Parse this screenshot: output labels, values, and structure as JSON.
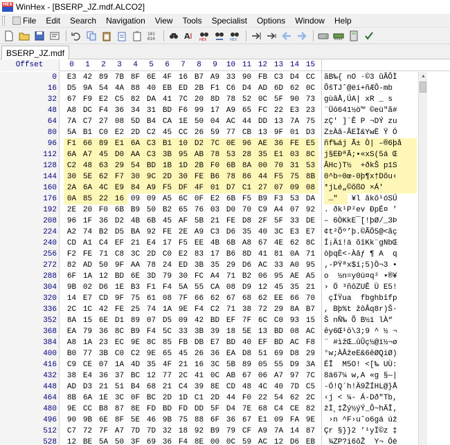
{
  "window": {
    "title": "WinHex - [BSERP_JZ.mdf.ALCO2]",
    "logo_text": "HEX"
  },
  "menu": [
    "File",
    "Edit",
    "Search",
    "Navigation",
    "View",
    "Tools",
    "Specialist",
    "Options",
    "Window",
    "Help"
  ],
  "toolbar": {
    "icons": [
      "new-file-icon",
      "open-file-icon",
      "save-icon",
      "properties-icon",
      "print-icon",
      "undo-icon",
      "copy-icon",
      "paste-icon",
      "paste-special-icon",
      "clipboard-icon",
      "binary-icon",
      "find-icon",
      "find-text-icon",
      "find-hex-icon",
      "replace-icon",
      "replace-hex-icon",
      "goto-offset-icon",
      "goto-jump-icon",
      "back-arrow-icon",
      "forward-arrow-icon",
      "disk-icon",
      "ram-icon",
      "calculator-icon",
      "checksum-icon"
    ]
  },
  "tab": {
    "label": "BSERP_JZ.mdf"
  },
  "hex": {
    "offset_label": "Offset",
    "columns": [
      "0",
      "1",
      "2",
      "3",
      "4",
      "5",
      "6",
      "7",
      "8",
      "9",
      "10",
      "11",
      "12",
      "13",
      "14",
      "15"
    ],
    "rows": [
      {
        "offset": "0",
        "bytes": [
          "E3",
          "42",
          "89",
          "7B",
          "8F",
          "6E",
          "4F",
          "16",
          "B7",
          "A9",
          "33",
          "90",
          "FB",
          "C3",
          "D4",
          "CC"
        ],
        "ascii": "ãB‰{ nO ·©3 ûÃÔÌ"
      },
      {
        "offset": "16",
        "bytes": [
          "D5",
          "9A",
          "54",
          "4A",
          "88",
          "40",
          "EB",
          "ED",
          "2B",
          "F1",
          "C6",
          "D4",
          "AD",
          "6D",
          "62",
          "0C"
        ],
        "ascii": "ÕšTJˆ@ëí+ñÆÔ-mb"
      },
      {
        "offset": "32",
        "bytes": [
          "67",
          "F9",
          "E2",
          "C5",
          "82",
          "DA",
          "41",
          "7C",
          "20",
          "8D",
          "78",
          "52",
          "0C",
          "5F",
          "90",
          "73"
        ],
        "ascii": "gùâÅ‚ÚA| xR _ s"
      },
      {
        "offset": "48",
        "bytes": [
          "A8",
          "DC",
          "F4",
          "36",
          "34",
          "31",
          "BD",
          "F6",
          "99",
          "17",
          "A9",
          "65",
          "FC",
          "22",
          "E3",
          "23"
        ],
        "ascii": "¨Üô641½ö™ ©eü\"ã#"
      },
      {
        "offset": "64",
        "bytes": [
          "7A",
          "C7",
          "27",
          "08",
          "5D",
          "B4",
          "CA",
          "1E",
          "50",
          "04",
          "AC",
          "44",
          "DD",
          "13",
          "7A",
          "75"
        ],
        "ascii": "zÇ' ]´Ê P ¬DÝ zu"
      },
      {
        "offset": "80",
        "bytes": [
          "5A",
          "B1",
          "C0",
          "E2",
          "2D",
          "C2",
          "45",
          "CC",
          "26",
          "59",
          "77",
          "CB",
          "13",
          "9F",
          "01",
          "D3"
        ],
        "ascii": "Z±Àâ-ÂEÌ&YwË Ÿ Ó"
      },
      {
        "offset": "96",
        "bytes": [
          "F1",
          "66",
          "89",
          "E1",
          "6A",
          "C3",
          "B1",
          "10",
          "D2",
          "7C",
          "0E",
          "96",
          "AE",
          "36",
          "FE",
          "E5"
        ],
        "ascii": "ñf‰áj Ã± Ò| –®6þå"
      },
      {
        "offset": "112",
        "bytes": [
          "6A",
          "A7",
          "45",
          "D0",
          "AA",
          "C3",
          "3B",
          "95",
          "AB",
          "78",
          "53",
          "28",
          "35",
          "E1",
          "03",
          "8C"
        ],
        "ascii": "j§EÐªÃ;•«xS(5á Œ"
      },
      {
        "offset": "128",
        "bytes": [
          "C2",
          "48",
          "63",
          "29",
          "54",
          "BD",
          "1B",
          "1D",
          "2B",
          "F0",
          "6B",
          "8A",
          "00",
          "70",
          "31",
          "53"
        ],
        "ascii": "ÂHc)T½  +ðkŠ p1S"
      },
      {
        "offset": "144",
        "bytes": [
          "30",
          "5E",
          "62",
          "F7",
          "30",
          "9C",
          "2D",
          "30",
          "FE",
          "B6",
          "78",
          "86",
          "44",
          "F5",
          "75",
          "8B"
        ],
        "ascii": "0^b÷0œ-0þ¶x†Dõu‹"
      },
      {
        "offset": "160",
        "bytes": [
          "2A",
          "6A",
          "4C",
          "E9",
          "84",
          "A9",
          "F5",
          "DF",
          "4F",
          "01",
          "D7",
          "C1",
          "27",
          "07",
          "09",
          "08"
        ],
        "ascii": "*jLé„©õßO ×Á'   "
      },
      {
        "offset": "176",
        "bytes": [
          "0A",
          "85",
          "22",
          "16",
          "09",
          "09",
          "A5",
          "6C",
          "0F",
          "E2",
          "6B",
          "F5",
          "B9",
          "F3",
          "53",
          "DA"
        ],
        "ascii": " …\"   ¥l âkõ¹óSÚ"
      },
      {
        "offset": "192",
        "bytes": [
          "2E",
          "20",
          "F0",
          "6B",
          "B9",
          "50",
          "B2",
          "65",
          "76",
          "03",
          "D0",
          "70",
          "C9",
          "A4",
          "07",
          "92"
        ],
        "ascii": ". ðk¹P²ev ÐpÉ¤ ’"
      },
      {
        "offset": "208",
        "bytes": [
          "96",
          "1F",
          "36",
          "D2",
          "4B",
          "6B",
          "45",
          "AF",
          "5B",
          "21",
          "FE",
          "D8",
          "2F",
          "5F",
          "33",
          "DE"
        ],
        "ascii": "– 6ÒKkE¯[!þØ/_3Þ"
      },
      {
        "offset": "224",
        "bytes": [
          "A2",
          "74",
          "B2",
          "D5",
          "BA",
          "92",
          "FE",
          "2E",
          "A9",
          "C3",
          "D6",
          "35",
          "40",
          "3C",
          "E3",
          "E7"
        ],
        "ascii": "¢t²Õº’þ.©ÃÖ5@<ãç"
      },
      {
        "offset": "240",
        "bytes": [
          "CD",
          "A1",
          "C4",
          "EF",
          "21",
          "E4",
          "17",
          "F5",
          "EE",
          "4B",
          "6B",
          "A8",
          "67",
          "4E",
          "62",
          "8C"
        ],
        "ascii": "Í¡Äï!ä õîKk¨gNbŒ"
      },
      {
        "offset": "256",
        "bytes": [
          "F2",
          "FE",
          "71",
          "C8",
          "3C",
          "2D",
          "C0",
          "E2",
          "83",
          "17",
          "B6",
          "8D",
          "41",
          "81",
          "0A",
          "71"
        ],
        "ascii": "òþqÈ<-Àâƒ ¶ A  q"
      },
      {
        "offset": "272",
        "bytes": [
          "82",
          "AD",
          "50",
          "9F",
          "AA",
          "78",
          "24",
          "ED",
          "3B",
          "35",
          "29",
          "D6",
          "AC",
          "33",
          "A0",
          "95"
        ],
        "ascii": "‚-PŸªx$í;5)Ö¬3 •"
      },
      {
        "offset": "288",
        "bytes": [
          "6F",
          "1A",
          "12",
          "BD",
          "6E",
          "3D",
          "79",
          "30",
          "FC",
          "A4",
          "71",
          "B2",
          "06",
          "95",
          "AE",
          "A5"
        ],
        "ascii": "o  ½n=y0ü¤q² •®¥"
      },
      {
        "offset": "304",
        "bytes": [
          "9B",
          "02",
          "D6",
          "1E",
          "B3",
          "F1",
          "F4",
          "5A",
          "55",
          "CA",
          "08",
          "D9",
          "12",
          "45",
          "35",
          "21"
        ],
        "ascii": "› Ö ³ñôZUÊ Ù E5!"
      },
      {
        "offset": "320",
        "bytes": [
          "14",
          "E7",
          "CD",
          "9F",
          "75",
          "61",
          "08",
          "7F",
          "66",
          "62",
          "67",
          "68",
          "62",
          "EE",
          "66",
          "70"
        ],
        "ascii": " çÍŸua  fbghbîfp"
      },
      {
        "offset": "336",
        "bytes": [
          "2C",
          "1C",
          "42",
          "FE",
          "25",
          "74",
          "1A",
          "9E",
          "F4",
          "C2",
          "71",
          "38",
          "72",
          "29",
          "8A",
          "B7"
        ],
        "ascii": ", Bþ%t žôÂq8r)Š·"
      },
      {
        "offset": "352",
        "bytes": [
          "8A",
          "15",
          "6E",
          "D1",
          "89",
          "07",
          "D5",
          "09",
          "42",
          "BD",
          "EF",
          "7F",
          "6C",
          "C0",
          "93",
          "15"
        ],
        "ascii": "Š nÑ‰ Õ B½ï lÀ“ "
      },
      {
        "offset": "368",
        "bytes": [
          "EA",
          "79",
          "36",
          "8C",
          "B9",
          "F4",
          "5C",
          "33",
          "3B",
          "39",
          "18",
          "5E",
          "13",
          "BD",
          "08",
          "AC"
        ],
        "ascii": "êy6Œ¹ô\\3;9 ^ ½ ¬"
      },
      {
        "offset": "384",
        "bytes": [
          "A8",
          "1A",
          "23",
          "EC",
          "9E",
          "8C",
          "85",
          "FB",
          "DB",
          "E7",
          "BD",
          "40",
          "EF",
          "BD",
          "AC",
          "F8"
        ],
        "ascii": "¨ #ìžŒ…ûÛç½@ï½¬ø"
      },
      {
        "offset": "400",
        "bytes": [
          "B0",
          "77",
          "3B",
          "C0",
          "C2",
          "9E",
          "65",
          "45",
          "26",
          "36",
          "EA",
          "D8",
          "51",
          "69",
          "D8",
          "29"
        ],
        "ascii": "°w;ÀÂžeE&6êØQiØ)"
      },
      {
        "offset": "416",
        "bytes": [
          "C9",
          "CE",
          "07",
          "1A",
          "4D",
          "35",
          "4F",
          "21",
          "16",
          "3C",
          "5B",
          "89",
          "05",
          "55",
          "D9",
          "3A"
        ],
        "ascii": "ÉÎ  M5O! <[‰ UÙ:"
      },
      {
        "offset": "432",
        "bytes": [
          "38",
          "E4",
          "36",
          "37",
          "BC",
          "12",
          "77",
          "2C",
          "41",
          "0C",
          "AB",
          "67",
          "06",
          "A7",
          "97",
          "7C"
        ],
        "ascii": "8ä67¼ w,A «g §—|"
      },
      {
        "offset": "448",
        "bytes": [
          "AD",
          "D3",
          "21",
          "51",
          "B4",
          "68",
          "21",
          "C4",
          "39",
          "8E",
          "CD",
          "48",
          "4C",
          "40",
          "7D",
          "C5"
        ],
        "ascii": "-Ó!Q´h!Ä9ŽÍHL@}Å"
      },
      {
        "offset": "464",
        "bytes": [
          "8B",
          "6A",
          "1E",
          "3C",
          "0F",
          "BC",
          "2D",
          "1D",
          "C1",
          "2D",
          "44",
          "F0",
          "22",
          "54",
          "62",
          "2C"
        ],
        "ascii": "‹j < ¼- Á-Dð\"Tb,"
      },
      {
        "offset": "480",
        "bytes": [
          "9E",
          "CC",
          "B8",
          "87",
          "8E",
          "FD",
          "BD",
          "FD",
          "DD",
          "5F",
          "D4",
          "7E",
          "68",
          "C4",
          "CE",
          "82"
        ],
        "ascii": "žÌ¸‡Žý½ýÝ_Ô~hÄÎ‚"
      },
      {
        "offset": "496",
        "bytes": [
          "90",
          "9B",
          "6E",
          "8F",
          "5E",
          "46",
          "9B",
          "75",
          "88",
          "6F",
          "36",
          "67",
          "E1",
          "09",
          "FA",
          "9E"
        ],
        "ascii": " ›n ^F›uˆo6gá úž"
      },
      {
        "offset": "512",
        "bytes": [
          "C7",
          "72",
          "7F",
          "A7",
          "7D",
          "7D",
          "32",
          "18",
          "92",
          "B9",
          "79",
          "CF",
          "A9",
          "7A",
          "14",
          "87"
        ],
        "ascii": "Çr §}}2 ’¹yÏ©z ‡"
      },
      {
        "offset": "528",
        "bytes": [
          "12",
          "BE",
          "5A",
          "50",
          "3F",
          "69",
          "36",
          "F4",
          "8E",
          "00",
          "0C",
          "59",
          "AC",
          "12",
          "D6",
          "EB"
        ],
        "ascii": " ¾ZP?i6ôŽ  Y¬ Öë"
      }
    ],
    "highlight_start": 96,
    "highlight_end": 179
  }
}
